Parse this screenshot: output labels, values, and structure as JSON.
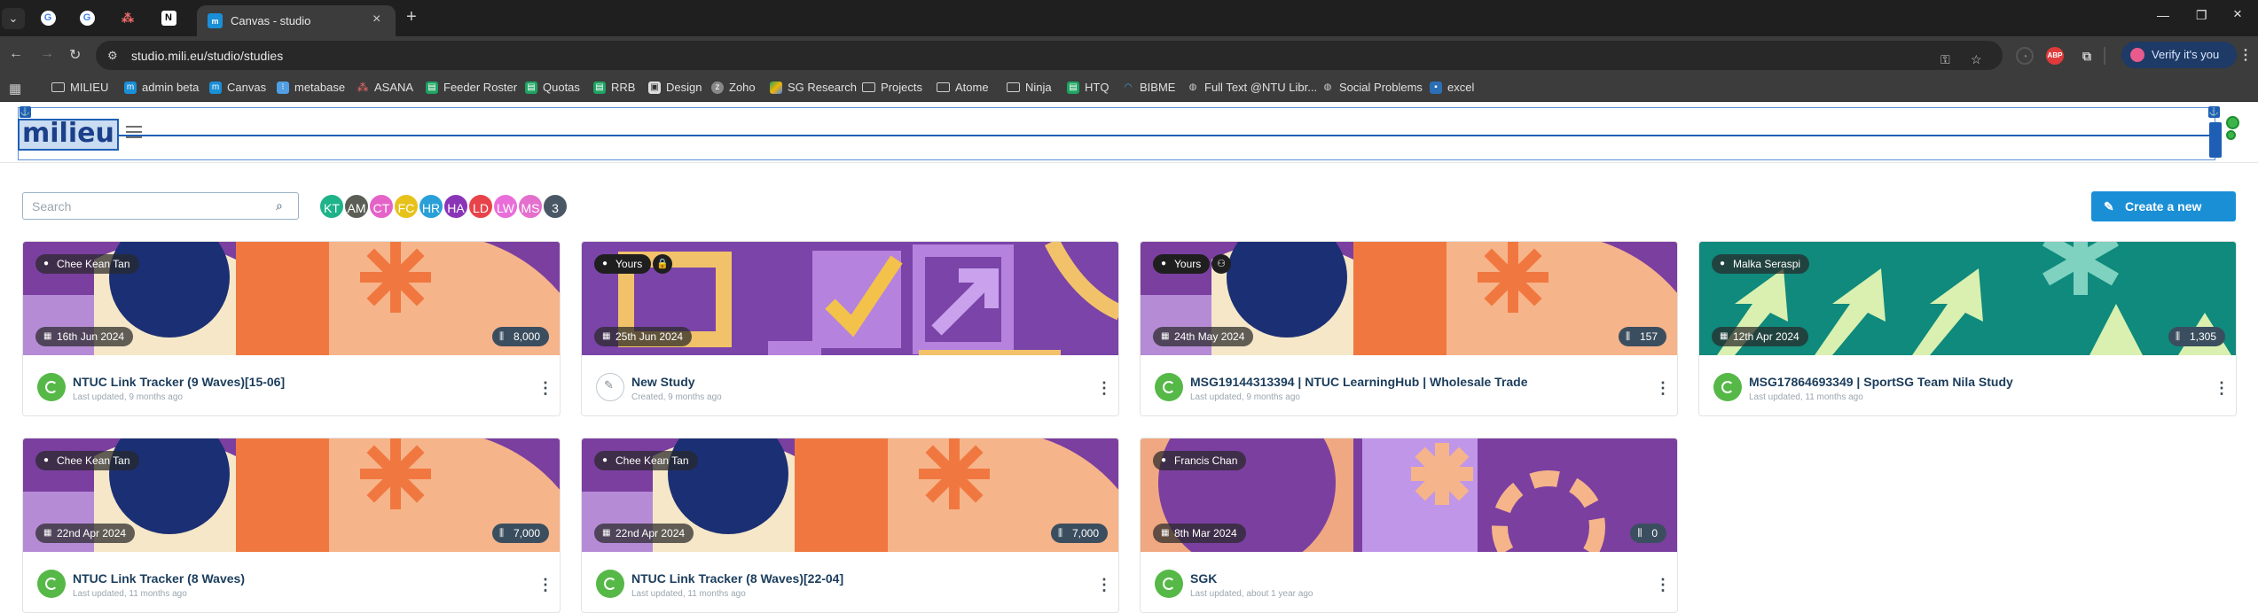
{
  "browser": {
    "tab_title": "Canvas - studio",
    "url": "studio.mili.eu/studio/studies",
    "verify_label": "Verify it's you",
    "bookmarks": [
      {
        "label": "MILIEU",
        "icon": "folder-icon"
      },
      {
        "label": "admin beta",
        "icon": "milieu-icon"
      },
      {
        "label": "Canvas",
        "icon": "milieu-icon"
      },
      {
        "label": "metabase",
        "icon": "metabase-icon"
      },
      {
        "label": "ASANA",
        "icon": "asana-icon"
      },
      {
        "label": "Feeder Roster",
        "icon": "sheets-icon"
      },
      {
        "label": "Quotas",
        "icon": "sheets-icon"
      },
      {
        "label": "RRB",
        "icon": "sheets-icon"
      },
      {
        "label": "Design",
        "icon": "design-icon"
      },
      {
        "label": "Zoho",
        "icon": "zoho-icon"
      },
      {
        "label": "SG Research",
        "icon": "drive-icon"
      },
      {
        "label": "Projects",
        "icon": "folder-icon"
      },
      {
        "label": "Atome",
        "icon": "folder-icon"
      },
      {
        "label": "Ninja",
        "icon": "folder-icon"
      },
      {
        "label": "HTQ",
        "icon": "sheets-icon"
      },
      {
        "label": "BIBME",
        "icon": "bibme-icon"
      },
      {
        "label": "Full Text @NTU Libr...",
        "icon": "globe-icon"
      },
      {
        "label": "Social Problems",
        "icon": "globe-icon"
      },
      {
        "label": "excel",
        "icon": "excel-icon"
      }
    ]
  },
  "app": {
    "logo": "milieu",
    "search_placeholder": "Search",
    "avatars": [
      {
        "initials": "KT",
        "color": "#1fb38a"
      },
      {
        "initials": "AM",
        "color": "#5b5e55"
      },
      {
        "initials": "CT",
        "color": "#e563c8"
      },
      {
        "initials": "FC",
        "color": "#e7c21a"
      },
      {
        "initials": "HR",
        "color": "#2aa0d8"
      },
      {
        "initials": "HA",
        "color": "#8a35b8"
      },
      {
        "initials": "LD",
        "color": "#e8434a"
      },
      {
        "initials": "LW",
        "color": "#e96ed9"
      },
      {
        "initials": "MS",
        "color": "#e46fcd"
      },
      {
        "initials": "3",
        "color": "#4a5866"
      }
    ],
    "create_label": "Create a new study"
  },
  "studies": [
    {
      "owner": "Chee Kean Tan",
      "date": "16th Jun 2024",
      "count": "8,000",
      "title": "NTUC Link Tracker (9 Waves)[15-06]",
      "subtitle": "Last updated, 9 months ago",
      "status": "live",
      "banner": "a"
    },
    {
      "owner": "Yours",
      "date": "25th Jun 2024",
      "count": "",
      "title": "New Study",
      "subtitle": "Created, 9 months ago",
      "status": "draft",
      "banner": "b",
      "locked": true
    },
    {
      "owner": "Yours",
      "date": "24th May 2024",
      "count": "157",
      "title": "MSG19144313394 | NTUC LearningHub | Wholesale Trade",
      "subtitle": "Last updated, 9 months ago",
      "status": "live",
      "banner": "a",
      "shared": true
    },
    {
      "owner": "Malka Seraspi",
      "date": "12th Apr 2024",
      "count": "1,305",
      "title": "MSG17864693349 | SportSG Team Nila Study",
      "subtitle": "Last updated, 11 months ago",
      "status": "live",
      "banner": "c"
    },
    {
      "owner": "Chee Kean Tan",
      "date": "22nd Apr 2024",
      "count": "7,000",
      "title": "NTUC Link Tracker (8 Waves)",
      "subtitle": "Last updated, 11 months ago",
      "status": "live",
      "banner": "a"
    },
    {
      "owner": "Chee Kean Tan",
      "date": "22nd Apr 2024",
      "count": "7,000",
      "title": "NTUC Link Tracker (8 Waves)[22-04]",
      "subtitle": "Last updated, 11 months ago",
      "status": "live",
      "banner": "a2"
    },
    {
      "owner": "Francis Chan",
      "date": "8th Mar 2024",
      "count": "0",
      "title": "SGK",
      "subtitle": "Last updated, about 1 year ago",
      "status": "live",
      "banner": "d"
    }
  ]
}
